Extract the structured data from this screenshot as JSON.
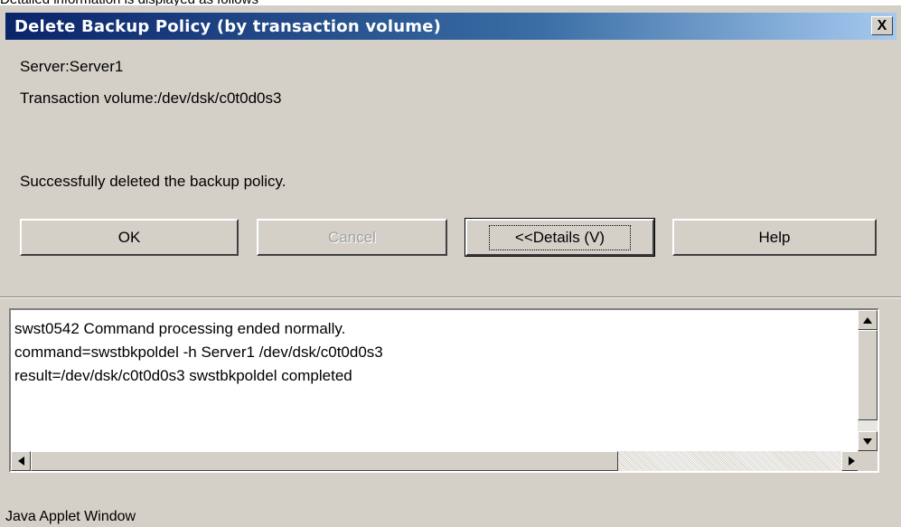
{
  "caption": "Detailed information is displayed as follows",
  "window": {
    "title": "Delete Backup Policy (by transaction volume)",
    "close_label": "X"
  },
  "info": {
    "server": "Server:Server1",
    "volume": "Transaction volume:/dev/dsk/c0t0d0s3",
    "message": "Successfully deleted the backup policy."
  },
  "buttons": {
    "ok": "OK",
    "cancel": "Cancel",
    "details": "<<Details (V)",
    "help": "Help"
  },
  "details": {
    "lines": [
      "swst0542 Command processing ended normally.",
      "command=swstbkpoldel -h Server1 /dev/dsk/c0t0d0s3",
      "result=/dev/dsk/c0t0d0s3 swstbkpoldel completed"
    ]
  },
  "status_bar": "Java Applet Window",
  "icons": {
    "scroll_up": "up-arrow-icon",
    "scroll_down": "down-arrow-icon",
    "scroll_left": "left-arrow-icon",
    "scroll_right": "right-arrow-icon"
  }
}
